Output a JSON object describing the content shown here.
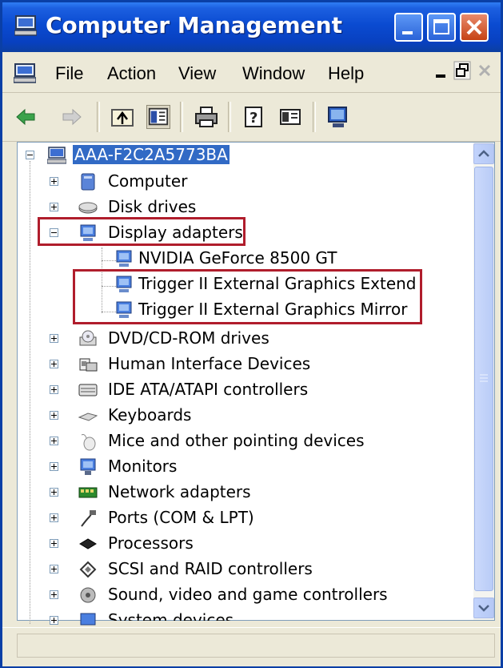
{
  "window": {
    "title": "Computer Management"
  },
  "menu": {
    "items": [
      "File",
      "Action",
      "View",
      "Window",
      "Help"
    ]
  },
  "toolbar": {
    "icons": [
      "back-arrow-icon",
      "forward-arrow-icon",
      "up-folder-icon",
      "show-hide-tree-icon",
      "print-icon",
      "help-icon",
      "properties-icon",
      "monitor-icon"
    ]
  },
  "tree": {
    "root": "AAA-F2C2A5773BA",
    "nodes": [
      {
        "label": "Computer",
        "expanded": false,
        "icon": "computer-icon"
      },
      {
        "label": "Disk drives",
        "expanded": false,
        "icon": "disk-drive-icon"
      },
      {
        "label": "Display adapters",
        "expanded": true,
        "icon": "display-adapter-icon"
      },
      {
        "label": "NVIDIA GeForce 8500 GT",
        "child": true,
        "icon": "display-adapter-icon"
      },
      {
        "label": "Trigger II External Graphics Extend",
        "child": true,
        "icon": "display-adapter-icon"
      },
      {
        "label": "Trigger II External Graphics Mirror",
        "child": true,
        "icon": "display-adapter-icon"
      },
      {
        "label": "DVD/CD-ROM drives",
        "expanded": false,
        "icon": "cdrom-icon"
      },
      {
        "label": "Human Interface Devices",
        "expanded": false,
        "icon": "hid-icon"
      },
      {
        "label": "IDE ATA/ATAPI controllers",
        "expanded": false,
        "icon": "ide-controller-icon"
      },
      {
        "label": "Keyboards",
        "expanded": false,
        "icon": "keyboard-icon"
      },
      {
        "label": "Mice and other pointing devices",
        "expanded": false,
        "icon": "mouse-icon"
      },
      {
        "label": "Monitors",
        "expanded": false,
        "icon": "monitor-icon"
      },
      {
        "label": "Network adapters",
        "expanded": false,
        "icon": "network-adapter-icon"
      },
      {
        "label": "Ports (COM & LPT)",
        "expanded": false,
        "icon": "port-icon"
      },
      {
        "label": "Processors",
        "expanded": false,
        "icon": "processor-icon"
      },
      {
        "label": "SCSI and RAID controllers",
        "expanded": false,
        "icon": "scsi-icon"
      },
      {
        "label": "Sound, video and game controllers",
        "expanded": false,
        "icon": "sound-icon"
      },
      {
        "label": "System devices",
        "expanded": false,
        "icon": "system-devices-icon"
      }
    ]
  },
  "colors": {
    "titlebar": "#0a4bd1",
    "selection": "#316ac5",
    "highlight_box": "#b01d2c"
  }
}
